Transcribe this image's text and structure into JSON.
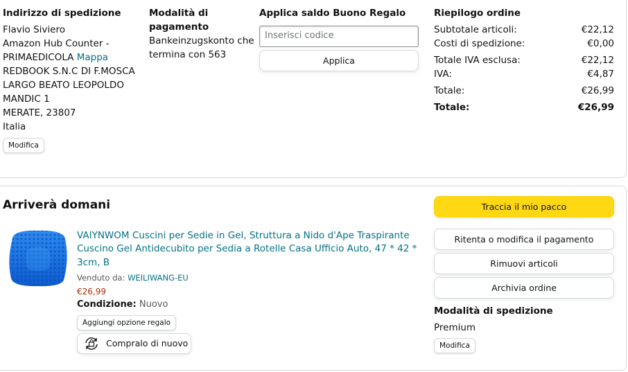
{
  "shipping": {
    "heading": "Indirizzo di spedizione",
    "name": "Flavio Siviero",
    "line1": "Amazon Hub Counter -",
    "line2_prefix": "PRIMAEDICOLA",
    "map_link": "Mappa",
    "line3": "REDBOOK S.N.C DI F.MOSCA",
    "line4": "LARGO BEATO LEOPOLDO",
    "line5": "MANDIC 1",
    "line6": "MERATE, 23807",
    "line7": "Italia",
    "edit_label": "Modifica"
  },
  "payment": {
    "heading_line1": "Modalità di",
    "heading_line2": "pagamento",
    "text_line1": "Bankeinzugskonto che",
    "text_line2": "termina con 563"
  },
  "gift": {
    "heading": "Applica saldo Buono Regalo",
    "placeholder": "Inserisci codice",
    "apply_label": "Applica"
  },
  "summary": {
    "heading": "Riepilogo ordine",
    "rows": [
      {
        "label": "Subtotale articoli:",
        "value": "€22,12"
      },
      {
        "label": "Costi di spedizione:",
        "value": "€0,00"
      },
      {
        "label": "Totale IVA esclusa:",
        "value": "€22,12"
      },
      {
        "label": "IVA:",
        "value": "€4,87"
      },
      {
        "label": "Totale:",
        "value": "€26,99"
      }
    ],
    "grand_total_label": "Totale:",
    "grand_total_value": "€26,99"
  },
  "delivery": {
    "title": "Arriverà domani",
    "product": {
      "title_line1": "VAIYNWOM Cuscini per Sedie in Gel, Struttura a Nido d'Ape Traspirante",
      "title_line2": "Cuscino Gel Antidecubito per Sedia a Rotelle Casa Ufficio Auto, 47 * 42 *",
      "title_line3": "3cm, B",
      "sold_by_label": "Venduto da:",
      "seller": "WEILIWANG-EU",
      "price": "€26,99",
      "condition_label": "Condizione:",
      "condition_value": "Nuovo",
      "gift_option_label": "Aggiungi opzione regalo",
      "buy_again_label": "Compralo di nuovo"
    },
    "actions": {
      "track": "Traccia il mio pacco",
      "retry_payment": "Ritenta o modifica il pagamento",
      "remove_items": "Rimuovi articoli",
      "archive_order": "Archivia ordine"
    },
    "shipping_method": {
      "heading": "Modalità di spedizione",
      "value": "Premium",
      "edit_label": "Modifica"
    }
  },
  "colors": {
    "link": "#007185",
    "price": "#b12704",
    "primary_button": "#ffd814",
    "border": "#d5d9d9"
  }
}
